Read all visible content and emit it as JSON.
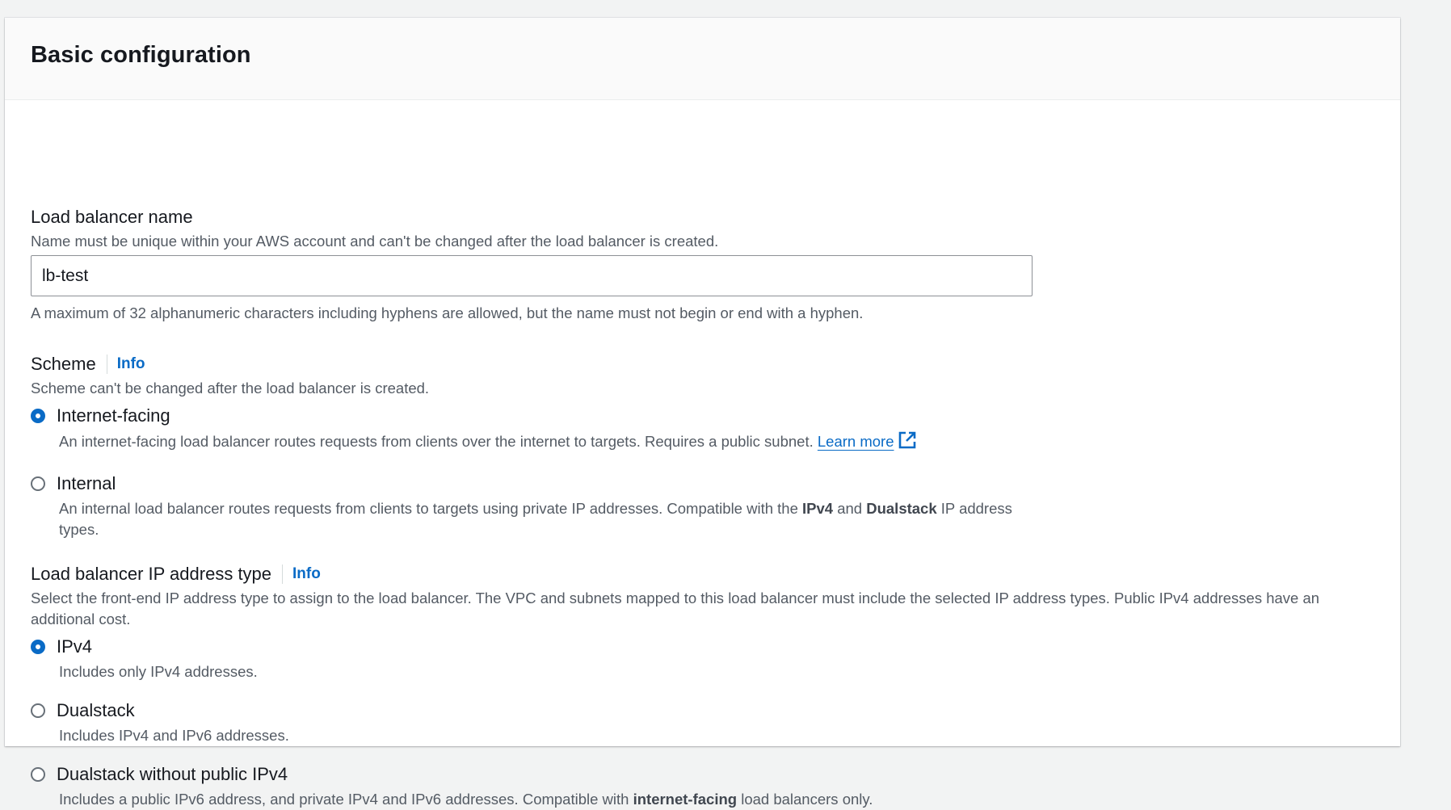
{
  "panel": {
    "title": "Basic configuration"
  },
  "name_field": {
    "label": "Load balancer name",
    "description": "Name must be unique within your AWS account and can't be changed after the load balancer is created.",
    "value": "lb-test",
    "constraint": "A maximum of 32 alphanumeric characters including hyphens are allowed, but the name must not begin or end with a hyphen."
  },
  "scheme": {
    "label": "Scheme",
    "info": "Info",
    "description": "Scheme can't be changed after the load balancer is created.",
    "options": [
      {
        "label": "Internet-facing",
        "selected": true,
        "description": "An internet-facing load balancer routes requests from clients over the internet to targets. Requires a public subnet.",
        "link": "Learn more",
        "link_icon": "external-link-icon"
      },
      {
        "label": "Internal",
        "selected": false,
        "description_pre": "An internal load balancer routes requests from clients to targets using private IP addresses. Compatible with the",
        "bold1": "IPv4",
        "mid": "and",
        "bold2": "Dualstack",
        "description_post": "IP address types."
      }
    ]
  },
  "ip_type": {
    "label": "Load balancer IP address type",
    "info": "Info",
    "description": "Select the front-end IP address type to assign to the load balancer. The VPC and subnets mapped to this load balancer must include the selected IP address types. Public IPv4 addresses have an additional cost.",
    "options": [
      {
        "label": "IPv4",
        "selected": true,
        "description": "Includes only IPv4 addresses."
      },
      {
        "label": "Dualstack",
        "selected": false,
        "description": "Includes IPv4 and IPv6 addresses."
      },
      {
        "label": "Dualstack without public IPv4",
        "selected": false,
        "description_pre": "Includes a public IPv6 address, and private IPv4 and IPv6 addresses. Compatible with",
        "bold": "internet-facing",
        "description_post": "load balancers only."
      }
    ]
  },
  "colors": {
    "accent": "#0a6bc6",
    "text": "#16191f",
    "secondary_text": "#545b64",
    "background": "#f2f3f3"
  }
}
